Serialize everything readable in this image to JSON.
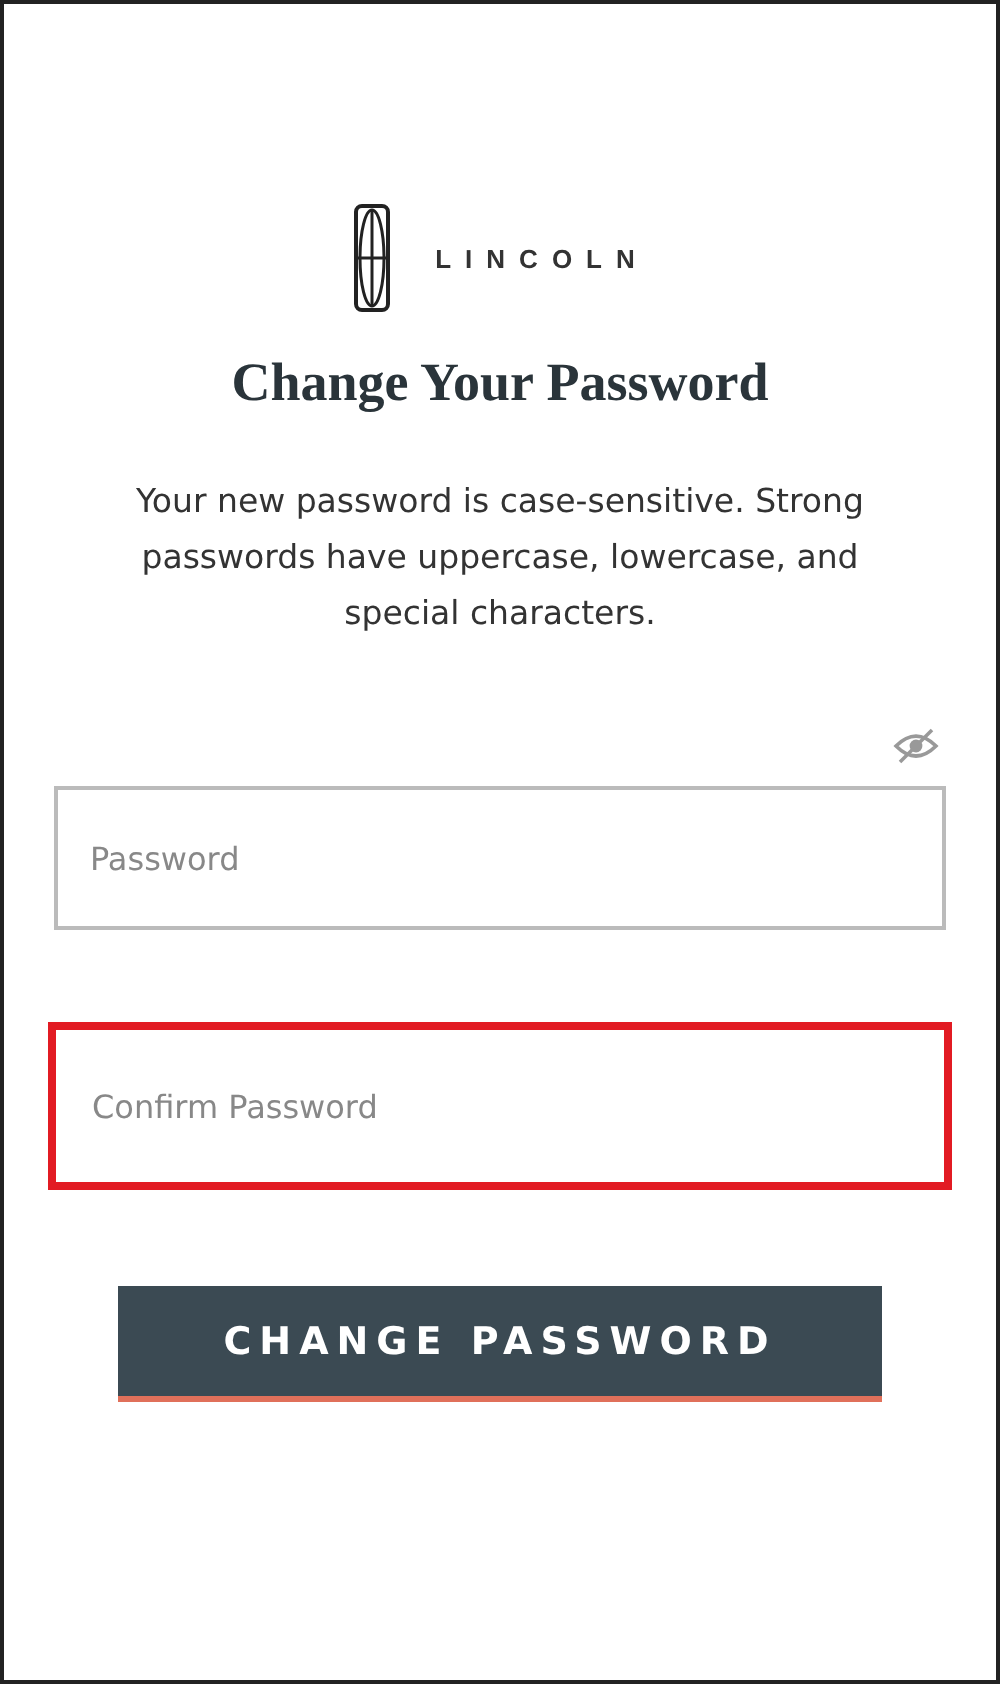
{
  "brand": {
    "name": "LINCOLN"
  },
  "title": "Change Your Password",
  "description": "Your new password is case-sensitive. Strong passwords have uppercase, lowercase, and special characters.",
  "password_visible": false,
  "fields": [
    {
      "placeholder": "Password",
      "highlighted": false
    },
    {
      "placeholder": "Confirm Password",
      "highlighted": true
    }
  ],
  "submit_button": "CHANGE PASSWORD"
}
